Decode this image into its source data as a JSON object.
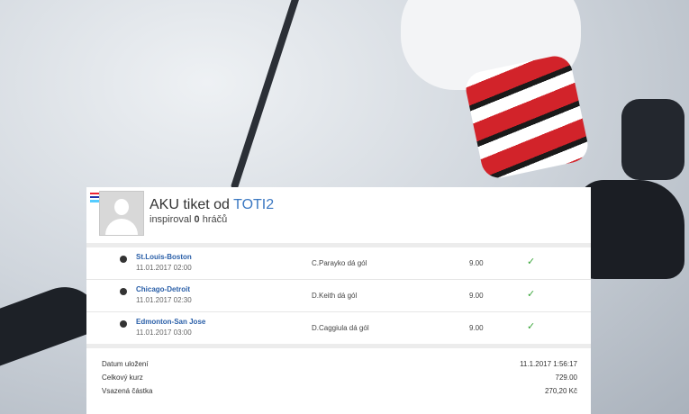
{
  "ticket": {
    "title_prefix": "AKU tiket od",
    "user": "TOTI2",
    "inspired_prefix": "inspiroval",
    "inspired_count": "0",
    "inspired_suffix": "hráčů"
  },
  "bets": [
    {
      "match": "St.Louis-Boston",
      "date": "11.01.2017 02:00",
      "tip": "C.Parayko dá gól",
      "odds": "9.00",
      "status_icon": "check-icon"
    },
    {
      "match": "Chicago-Detroit",
      "date": "11.01.2017 02:30",
      "tip": "D.Keith dá gól",
      "odds": "9.00",
      "status_icon": "check-icon"
    },
    {
      "match": "Edmonton-San Jose",
      "date": "11.01.2017 03:00",
      "tip": "D.Caggiula dá gól",
      "odds": "9.00",
      "status_icon": "check-icon"
    }
  ],
  "summary": {
    "saved_label": "Datum uložení",
    "saved_value": "11.1.2017 1:56:17",
    "total_odds_label": "Celkový kurz",
    "total_odds_value": "729.00",
    "stake_label": "Vsazená částka",
    "stake_value": "270,20 Kč"
  },
  "colors": {
    "link": "#3b78c2",
    "success": "#3aa53a"
  }
}
